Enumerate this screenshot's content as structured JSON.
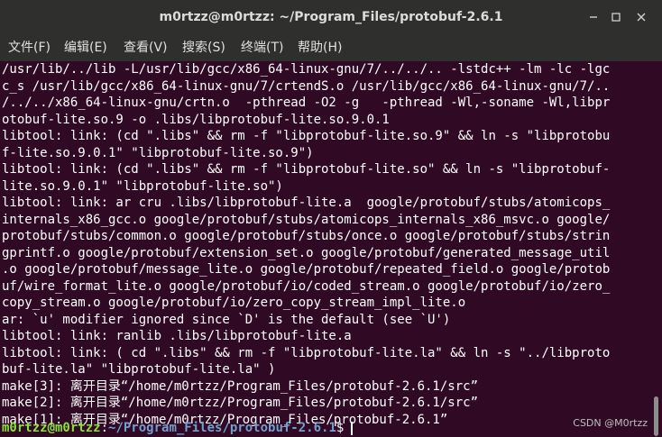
{
  "window": {
    "title": "m0rtzz@m0rtzz: ~/Program_Files/protobuf-2.6.1",
    "menu": [
      "文件(F)",
      "编辑(E)",
      "查看(V)",
      "搜索(S)",
      "终端(T)",
      "帮助(H)"
    ]
  },
  "terminal": {
    "lines": [
      "/usr/lib/../lib -L/usr/lib/gcc/x86_64-linux-gnu/7/../../.. -lstdc++ -lm -lc -lgc",
      "c_s /usr/lib/gcc/x86_64-linux-gnu/7/crtendS.o /usr/lib/gcc/x86_64-linux-gnu/7/..",
      "/../../x86_64-linux-gnu/crtn.o  -pthread -O2 -g   -pthread -Wl,-soname -Wl,libpr",
      "otobuf-lite.so.9 -o .libs/libprotobuf-lite.so.9.0.1",
      "libtool: link: (cd \".libs\" && rm -f \"libprotobuf-lite.so.9\" && ln -s \"libprotobu",
      "f-lite.so.9.0.1\" \"libprotobuf-lite.so.9\")",
      "libtool: link: (cd \".libs\" && rm -f \"libprotobuf-lite.so\" && ln -s \"libprotobuf-",
      "lite.so.9.0.1\" \"libprotobuf-lite.so\")",
      "libtool: link: ar cru .libs/libprotobuf-lite.a  google/protobuf/stubs/atomicops_",
      "internals_x86_gcc.o google/protobuf/stubs/atomicops_internals_x86_msvc.o google/",
      "protobuf/stubs/common.o google/protobuf/stubs/once.o google/protobuf/stubs/strin",
      "gprintf.o google/protobuf/extension_set.o google/protobuf/generated_message_util",
      ".o google/protobuf/message_lite.o google/protobuf/repeated_field.o google/protob",
      "uf/wire_format_lite.o google/protobuf/io/coded_stream.o google/protobuf/io/zero_",
      "copy_stream.o google/protobuf/io/zero_copy_stream_impl_lite.o",
      "ar: `u' modifier ignored since `D' is the default (see `U')",
      "libtool: link: ranlib .libs/libprotobuf-lite.a",
      "libtool: link: ( cd \".libs\" && rm -f \"libprotobuf-lite.la\" && ln -s \"../libproto",
      "buf-lite.la\" \"libprotobuf-lite.la\" )",
      "make[3]: 离开目录“/home/m0rtzz/Program_Files/protobuf-2.6.1/src”",
      "make[2]: 离开目录“/home/m0rtzz/Program_Files/protobuf-2.6.1/src”",
      "make[1]: 离开目录“/home/m0rtzz/Program_Files/protobuf-2.6.1”"
    ],
    "prompt": {
      "user_host": "m0rtzz@m0rtzz",
      "separator": ":",
      "path": "~/Program_Files/protobuf-2.6.1",
      "symbol": "$"
    }
  },
  "watermark": "CSDN @M0rtzz",
  "colors": {
    "terminal_bg": "#300a24",
    "prompt_user": "#8ae234",
    "prompt_path": "#729fcf",
    "titlebar_bg": "#2f2f2d"
  }
}
